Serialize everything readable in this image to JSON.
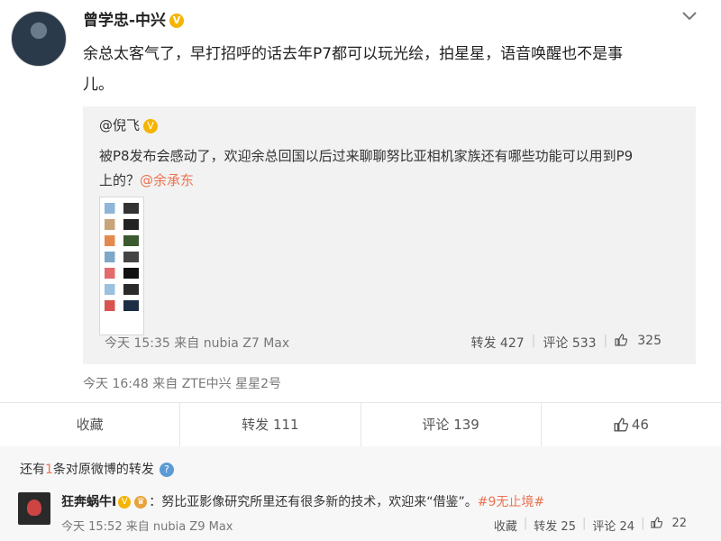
{
  "post": {
    "author": "曾学忠-中兴",
    "verified_mark": "V",
    "text_line1": "余总太客气了，早打招呼的话去年P7都可以玩光绘，拍星星，语音唤醒也不是事",
    "text_line2": "儿。",
    "meta": "今天 16:48 来自 ZTE中兴 星星2号",
    "actions": {
      "favorite": "收藏",
      "repost": "转发 111",
      "comment": "评论 139",
      "like": "46"
    }
  },
  "quoted": {
    "author": "@倪飞",
    "text_line1": "被P8发布会感动了，欢迎余总回国以后过来聊聊努比亚相机家族还有哪些功能可以用到P9",
    "text_line2_prefix": "上的？",
    "mention": "@余承东",
    "meta": "今天 15:35 来自 nubia Z7 Max",
    "repost": "转发 427",
    "comment": "评论 533",
    "like": "325"
  },
  "more_reposts": {
    "label_prefix": "还有",
    "label_count": "1",
    "label_suffix": "条对原微博的转发",
    "help_mark": "?"
  },
  "repost_item": {
    "name": "狂奔蜗牛I",
    "badge": "V",
    "text": "：努比亚影像研究所里还有很多新的技术，欢迎来“借鉴”。",
    "hashtag": "#9无止境#",
    "meta": "今天 15:52 来自 nubia Z9 Max",
    "favorite": "收藏",
    "repost": "转发 25",
    "comment": "评论 24",
    "like": "22"
  },
  "icons": {
    "chevron": "chevron-down-icon",
    "like": "thumbs-up-icon"
  },
  "colors": {
    "accent": "#eb7350",
    "verified": "#f5b400",
    "quote_bg": "#f2f2f2"
  }
}
